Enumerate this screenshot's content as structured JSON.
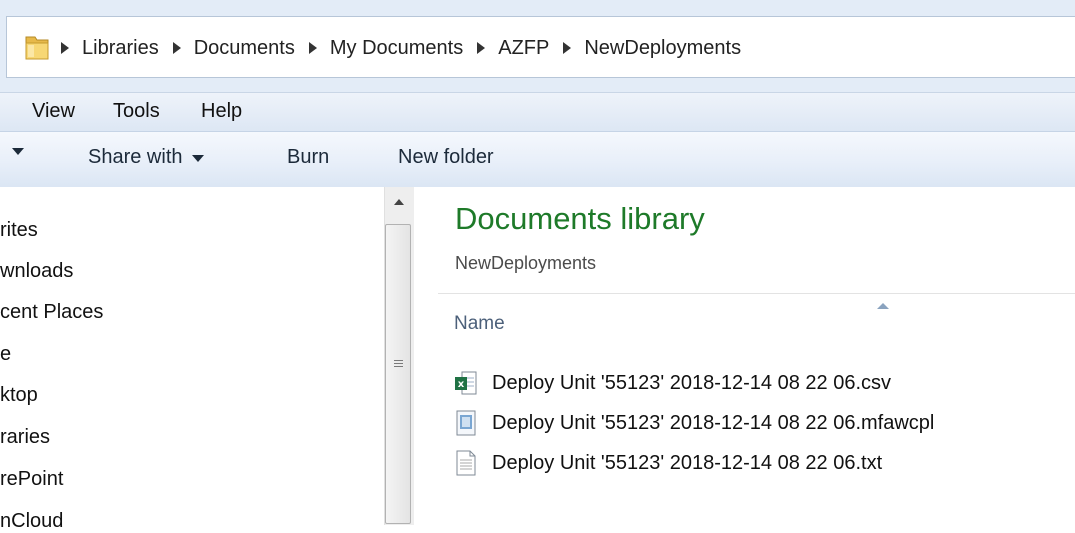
{
  "breadcrumb": [
    "Libraries",
    "Documents",
    "My Documents",
    "AZFP",
    "NewDeployments"
  ],
  "menu": [
    "View",
    "Tools",
    "Help"
  ],
  "commands": {
    "share_with": "Share with",
    "burn": "Burn",
    "new_folder": "New folder"
  },
  "nav_items": [
    "rites",
    "wnloads",
    "cent Places",
    "e",
    "ktop",
    "raries",
    "rePoint",
    "nCloud"
  ],
  "library": {
    "title": "Documents library",
    "subtitle": "NewDeployments"
  },
  "columns": {
    "name": "Name"
  },
  "files": [
    {
      "name": "Deploy Unit '55123' 2018-12-14 08 22 06.csv",
      "icon": "excel-csv-icon"
    },
    {
      "name": "Deploy Unit '55123' 2018-12-14 08 22 06.mfawcpl",
      "icon": "generic-file-icon"
    },
    {
      "name": "Deploy Unit '55123' 2018-12-14 08 22 06.txt",
      "icon": "text-file-icon"
    }
  ],
  "colors": {
    "library_title": "#1e7a29",
    "excel_green": "#207245",
    "toolbar_bg": "#dde7f4"
  }
}
